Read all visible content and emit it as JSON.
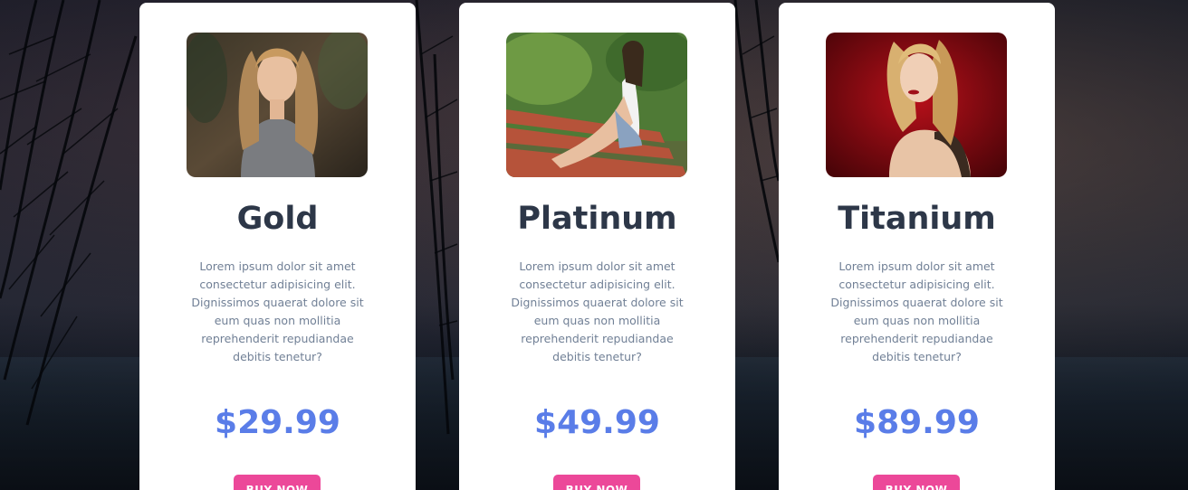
{
  "plans": [
    {
      "name": "Gold",
      "description": "Lorem ipsum dolor sit amet consectetur adipisicing elit. Dignissimos quaerat dolore sit eum quas non mollitia reprehenderit repudiandae debitis tenetur?",
      "price": "$29.99",
      "button_label": "BUY NOW"
    },
    {
      "name": "Platinum",
      "description": "Lorem ipsum dolor sit amet consectetur adipisicing elit. Dignissimos quaerat dolore sit eum quas non mollitia reprehenderit repudiandae debitis tenetur?",
      "price": "$49.99",
      "button_label": "BUY NOW"
    },
    {
      "name": "Titanium",
      "description": "Lorem ipsum dolor sit amet consectetur adipisicing elit. Dignissimos quaerat dolore sit eum quas non mollitia reprehenderit repudiandae debitis tenetur?",
      "price": "$89.99",
      "button_label": "BUY NOW"
    }
  ],
  "colors": {
    "title": "#2d3748",
    "description": "#718096",
    "price": "#5a7de8",
    "button": "#ec4899",
    "card": "#ffffff"
  }
}
